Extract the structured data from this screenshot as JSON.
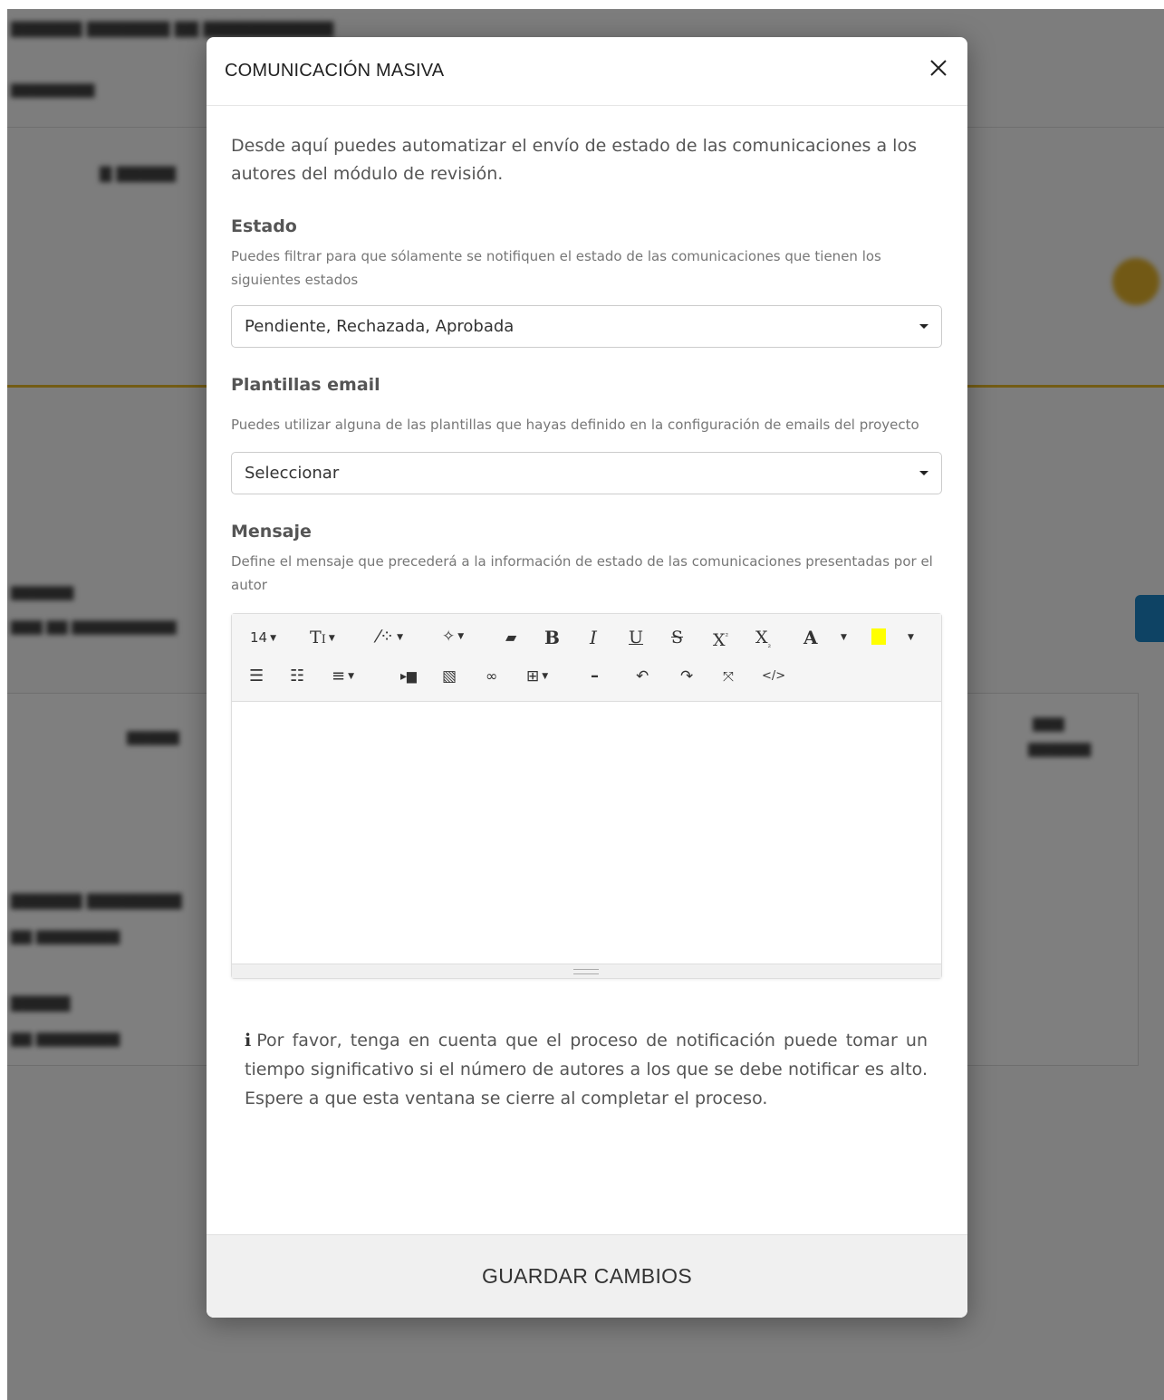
{
  "modal": {
    "title": "COMUNICACIÓN MASIVA",
    "intro": "Desde aquí puedes automatizar el envío de estado de las comunicaciones a los autores del módulo de revisión.",
    "estado": {
      "label": "Estado",
      "help": "Puedes filtrar para que sólamente se notifiquen el estado de las comunicaciones que tienen los siguientes estados",
      "value": "Pendiente, Rechazada, Aprobada"
    },
    "plantillas": {
      "label": "Plantillas email",
      "help": "Puedes utilizar alguna de las plantillas que hayas definido en la configuración de emails del proyecto",
      "value": "Seleccionar"
    },
    "mensaje": {
      "label": "Mensaje",
      "help": "Define el mensaje que precederá a la información de estado de las comunicaciones presentadas por el autor"
    },
    "toolbar": {
      "font_size": "14",
      "highlight_color": "#ffff00",
      "icons": [
        "font-size",
        "text-style",
        "magic-wand",
        "sparkle",
        "eraser",
        "bold",
        "italic",
        "underline",
        "strikethrough",
        "superscript",
        "subscript",
        "font-color",
        "highlight-color",
        "bullet-list",
        "numbered-list",
        "align",
        "indent",
        "image",
        "link",
        "table",
        "horizontal-rule",
        "undo",
        "redo",
        "fullscreen",
        "code-view"
      ]
    },
    "notice": "Por favor, tenga en cuenta que el proceso de notificación puede tomar un tiempo significativo si el número de autores a los que se debe notificar es alto. Espere a que esta ventana se cierre al completar el proceso.",
    "save_label": "GUARDAR CAMBIOS"
  }
}
